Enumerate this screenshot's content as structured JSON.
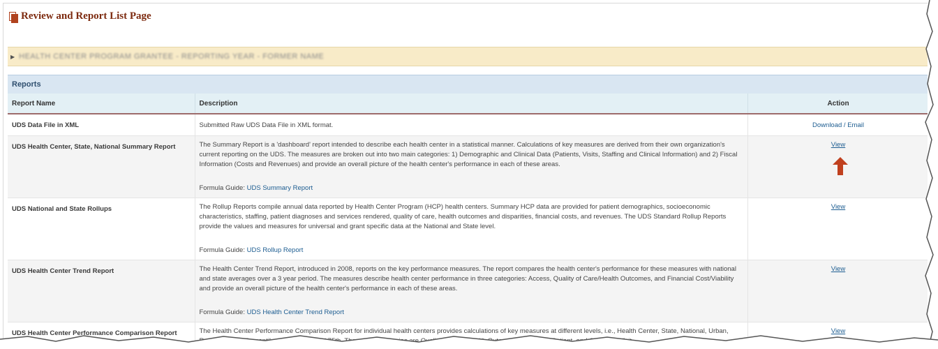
{
  "page": {
    "title": "Review and Report List Page",
    "icon": "document-icon"
  },
  "banner": {
    "text": "HEALTH CENTER PROGRAM GRANTEE - REPORTING YEAR - FORMER NAME"
  },
  "reports": {
    "section_title": "Reports",
    "columns": {
      "name": "Report Name",
      "description": "Description",
      "action": "Action"
    },
    "rows": [
      {
        "name": "UDS Data File in XML",
        "description": "Submitted Raw UDS Data File in XML format.",
        "formula_label": "",
        "formula_link": "",
        "action": "Download / Email"
      },
      {
        "name": "UDS Health Center, State, National Summary Report",
        "description": "The Summary Report is a 'dashboard' report intended to describe each health center in a statistical manner. Calculations of key measures are derived from their own organization's current reporting on the UDS. The measures are broken out into two main categories: 1) Demographic and Clinical Data (Patients, Visits, Staffing and Clinical Information) and 2) Fiscal Information (Costs and Revenues) and provide an overall picture of the health center's performance in each of these areas.",
        "formula_label": "Formula Guide:",
        "formula_link": "UDS Summary Report",
        "action": "View"
      },
      {
        "name": "UDS National and State Rollups",
        "description": "The Rollup Reports compile annual data reported by Health Center Program (HCP) health centers. Summary HCP data are provided for patient demographics, socioeconomic characteristics, staffing, patient diagnoses and services rendered, quality of care, health outcomes and disparities, financial costs, and revenues. The UDS Standard Rollup Reports provide the values and measures for universal and grant specific data at the National and State level.",
        "formula_label": "Formula Guide:",
        "formula_link": "UDS Rollup Report",
        "action": "View"
      },
      {
        "name": "UDS Health Center Trend Report",
        "description": "The Health Center Trend Report, introduced in 2008, reports on the key performance measures. The report compares the health center's performance for these measures with national and state averages over a 3 year period. The measures describe health center performance in three categories: Access, Quality of Care/Health Outcomes, and Financial Cost/Viability and provide an overall picture of the health center's performance in each of these areas.",
        "formula_label": "Formula Guide:",
        "formula_link": "UDS Health Center Trend Report",
        "action": "View"
      },
      {
        "name": "UDS Health Center Performance Comparison Report",
        "description": "The Health Center Performance Comparison Report for individual health centers provides calculations of key measures at different levels, i.e., Health Center, State, National, Urban, Rural, National Percentiles (25th, 50th, and 75th. The report categories are Quality of Care/Health Outcomes, Costs per Patient, and Costs per Visit.",
        "formula_label": "",
        "formula_link": "",
        "action": "View"
      }
    ]
  },
  "annotation": {
    "arrow_icon": "up-arrow-icon",
    "arrow_color": "#c0401e"
  },
  "colors": {
    "title": "#7d2b10",
    "banner_bg": "#f8ebc8",
    "section_header_bg": "#d9e6f2",
    "table_header_bg": "#e3f0f5",
    "link": "#1d5d91"
  }
}
